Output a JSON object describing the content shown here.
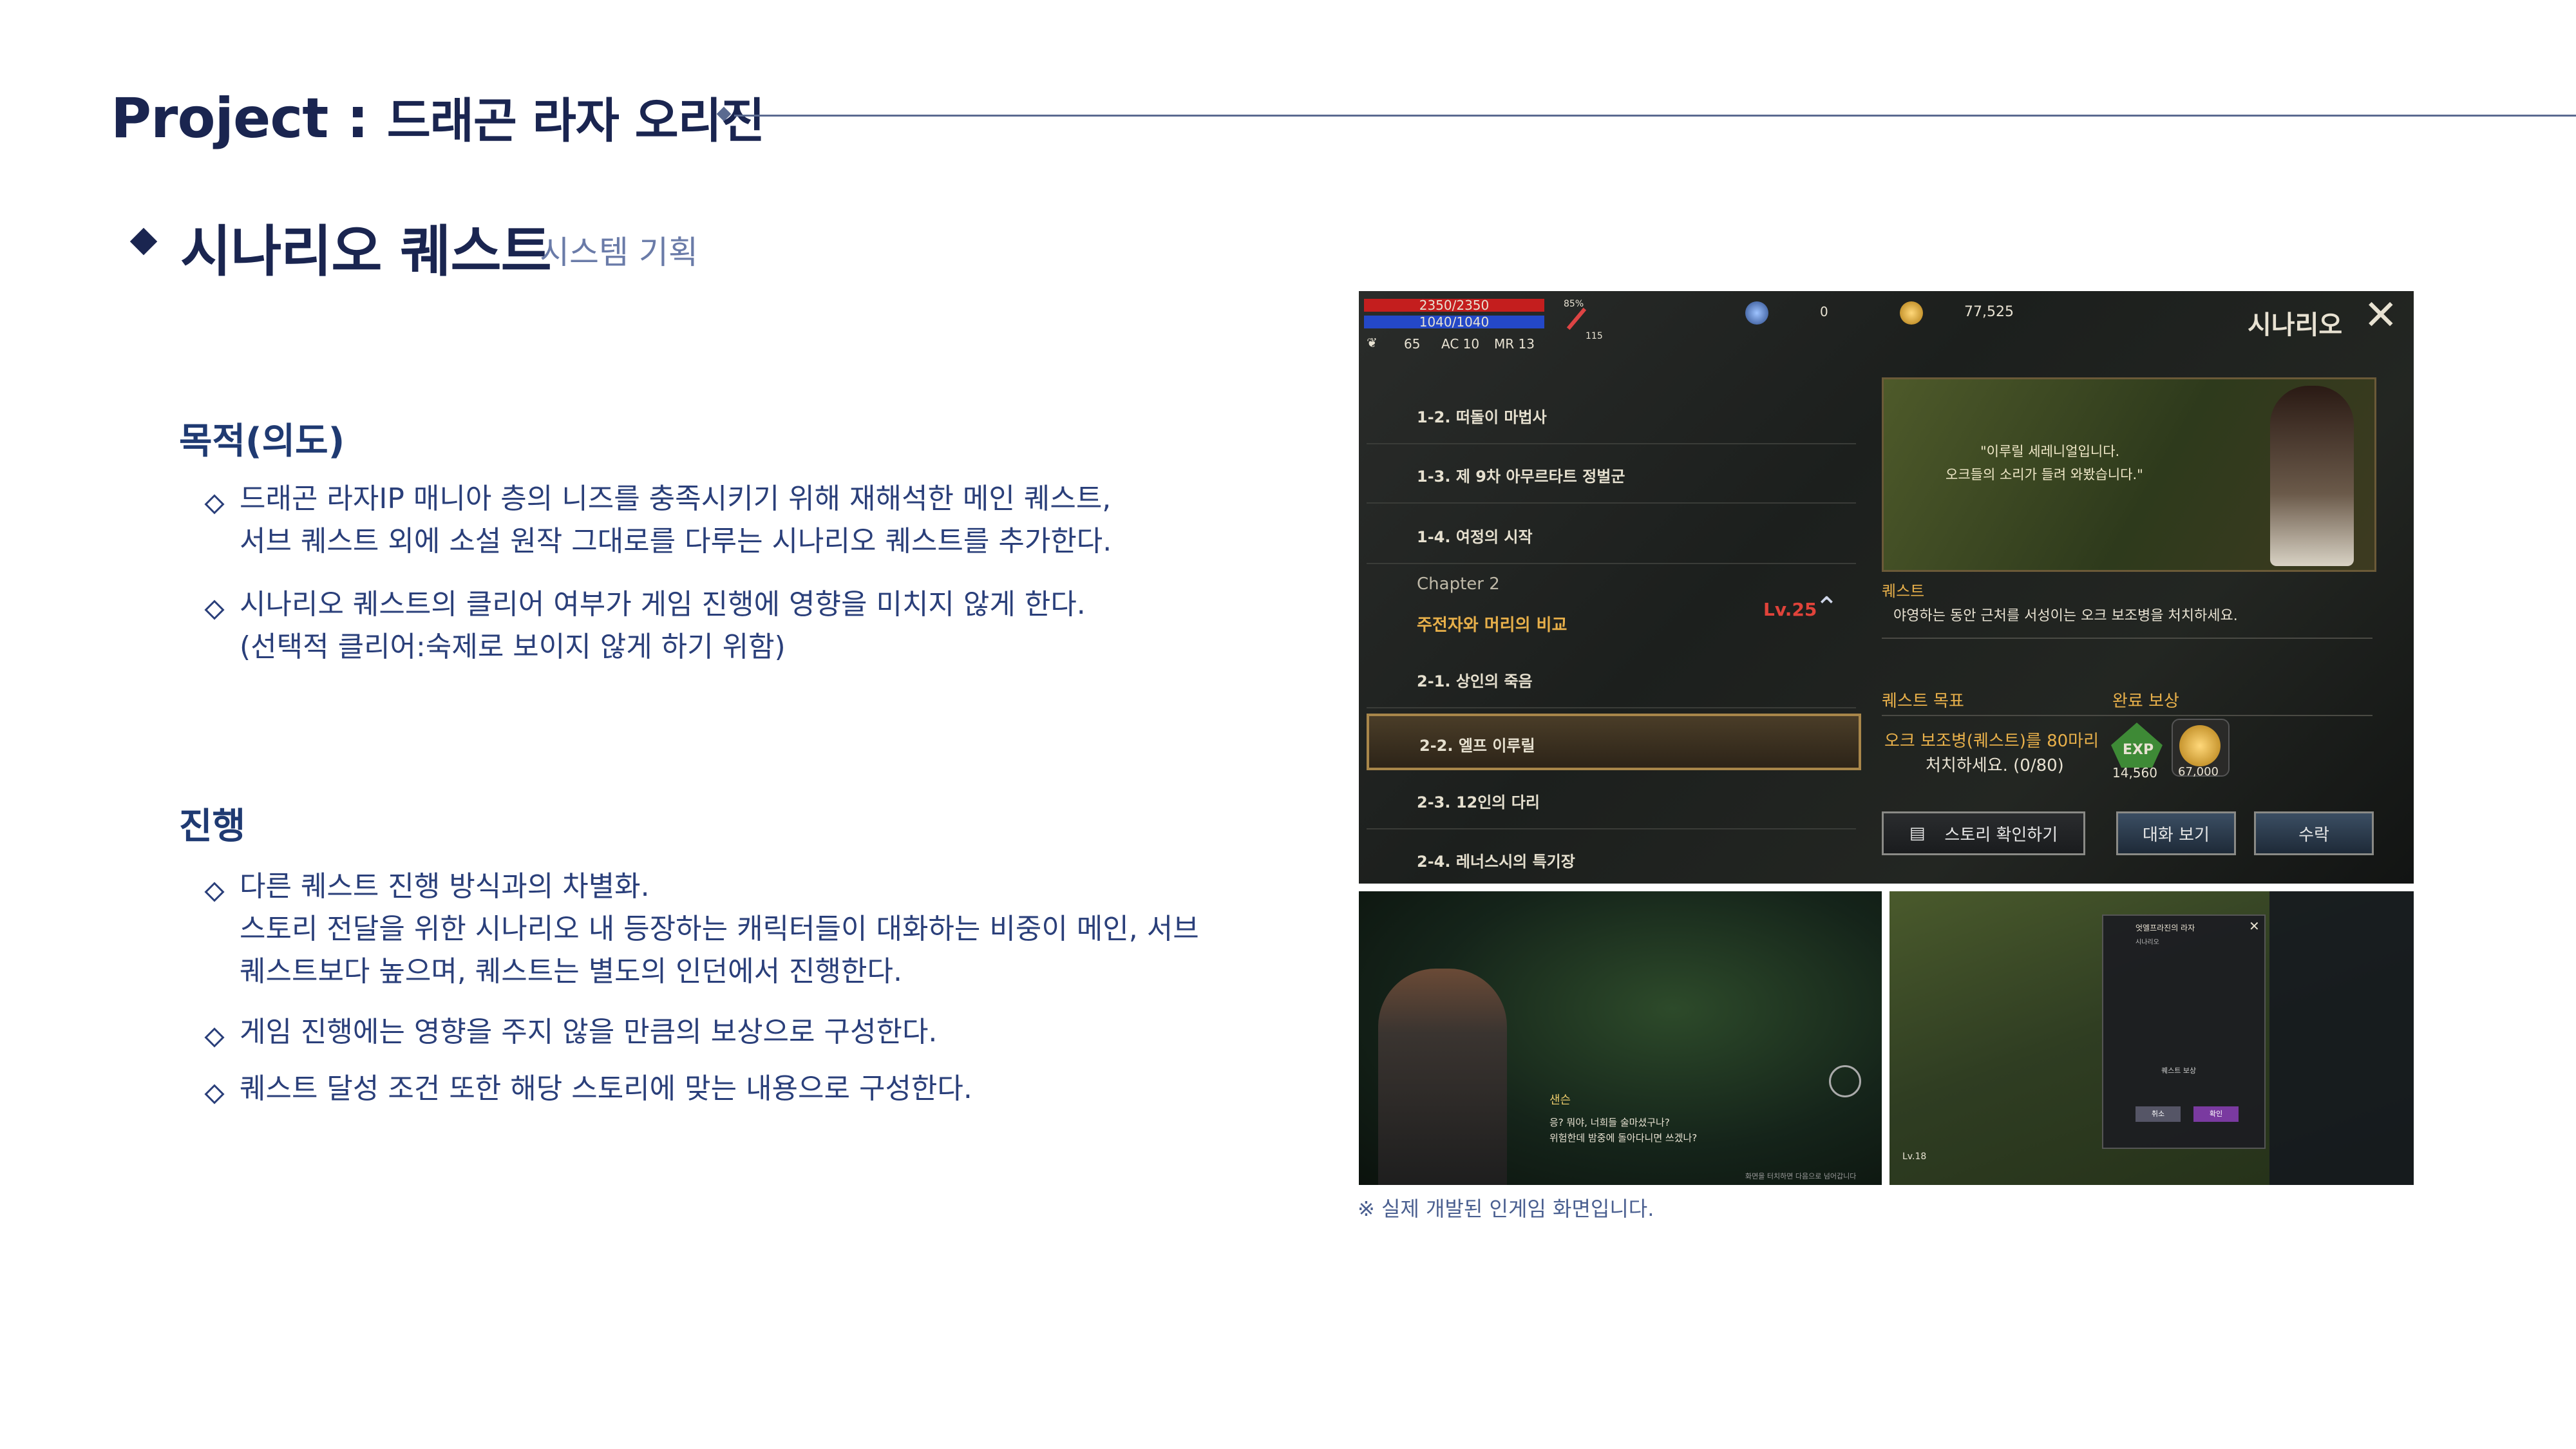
{
  "header": {
    "title_main": "Project",
    "title_colon": " : ",
    "title_sub": "드래곤 라자 오리진"
  },
  "section": {
    "title": "시나리오 퀘스트",
    "subtitle": "시스템 기획"
  },
  "purpose": {
    "heading": "목적(의도)",
    "bullets": [
      {
        "lines": [
          "드래곤 라자IP 매니아 층의 니즈를 충족시키기 위해 재해석한 메인 퀘스트,",
          "서브 퀘스트 외에 소설 원작 그대로를 다루는 시나리오 퀘스트를 추가한다."
        ]
      },
      {
        "lines": [
          "시나리오 퀘스트의 클리어 여부가 게임 진행에 영향을 미치지 않게 한다.",
          "(선택적 클리어:숙제로 보이지 않게 하기 위함)"
        ]
      }
    ]
  },
  "progress": {
    "heading": "진행",
    "bullets": [
      {
        "lines": [
          "다른 퀘스트 진행 방식과의 차별화.",
          "스토리 전달을 위한 시나리오 내 등장하는 캐릭터들이 대화하는 비중이 메인, 서브",
          "퀘스트보다 높으며, 퀘스트는 별도의 인던에서 진행한다."
        ]
      },
      {
        "lines": [
          "게임 진행에는 영향을 주지 않을 만큼의 보상으로 구성한다."
        ]
      },
      {
        "lines": [
          "퀘스트 달성 조건 또한 해당 스토리에 맞는 내용으로 구성한다."
        ]
      }
    ]
  },
  "game_main": {
    "hp": "2350/2350",
    "mp": "1040/1040",
    "level_small": "65",
    "ac": "AC 10",
    "mr": "MR 13",
    "percent": "85%",
    "ammo": "115",
    "currency1": "0",
    "currency2": "77,525",
    "screen_title": "시나리오",
    "quests": [
      {
        "label": "1-2. 떠돌이 마법사"
      },
      {
        "label": "1-3. 제 9차 아무르타트 정벌군"
      },
      {
        "label": "1-4. 여정의 시작"
      }
    ],
    "chapter": "Chapter 2",
    "chapter_name": "주전자와 머리의 비교",
    "chapter_level": "Lv.25",
    "quests2": [
      {
        "label": "2-1. 상인의 죽음"
      },
      {
        "label": "2-2. 엘프 이루릴"
      },
      {
        "label": "2-3. 12인의 다리"
      },
      {
        "label": "2-4. 레너스시의 특기장"
      }
    ],
    "dialog_line1": "\"이루릴 세레니얼입니다.",
    "dialog_line2": "오크들의 소리가 들려 와봤습니다.\"",
    "quest_label": "퀘스트",
    "quest_desc": "야영하는 동안 근처를 서성이는 오크 보조병을 처치하세요.",
    "goal_label": "퀘스트 목표",
    "reward_label": "완료 보상",
    "goal_line1": "오크 보조병(퀘스트)를 80마리",
    "goal_line2": "처치하세요. (0/80)",
    "exp_label": "EXP",
    "exp_value": "14,560",
    "gold_value": "67,000",
    "btn_story": "스토리 확인하기",
    "btn_talk": "대화 보기",
    "btn_accept": "수락"
  },
  "game_a": {
    "speaker": "샌슨",
    "line1": "응? 뭐야, 너희들 술마셨구나?",
    "line2": "위험한데 밤중에 돌아다니면 쓰겠나?",
    "hint": "화면을 터치하면 다음으로 넘어갑니다"
  },
  "game_b": {
    "popup_title": "엇엘프라진의 라자",
    "popup_sub": "시나리오",
    "reward_title": "퀘스트 보상",
    "btn_cancel": "취소",
    "btn_ok": "확인",
    "level": "Lv.18"
  },
  "caption": "※ 실제 개발된 인게임 화면입니다."
}
